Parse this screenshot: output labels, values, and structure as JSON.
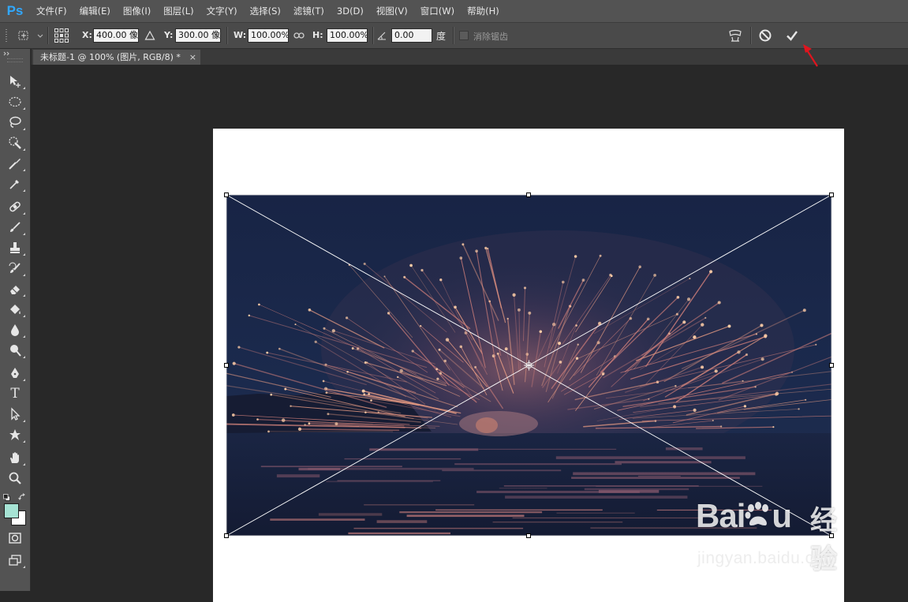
{
  "app": {
    "logo": "Ps",
    "accent_color": "#31a8ff"
  },
  "menu": [
    {
      "label": "文件(F)"
    },
    {
      "label": "编辑(E)"
    },
    {
      "label": "图像(I)"
    },
    {
      "label": "图层(L)"
    },
    {
      "label": "文字(Y)"
    },
    {
      "label": "选择(S)"
    },
    {
      "label": "滤镜(T)"
    },
    {
      "label": "3D(D)"
    },
    {
      "label": "视图(V)"
    },
    {
      "label": "窗口(W)"
    },
    {
      "label": "帮助(H)"
    }
  ],
  "options": {
    "x_label": "X:",
    "x_value": "400.00 像",
    "y_label": "Y:",
    "y_value": "300.00 像",
    "w_label": "W:",
    "w_value": "100.00%",
    "h_label": "H:",
    "h_value": "100.00%",
    "angle_value": "0.00",
    "angle_unit": "度",
    "antialias_label": "消除锯齿",
    "antialias_checked": false,
    "icons": [
      "transform-tool-icon",
      "reference-point-icon",
      "relative-delta-icon",
      "link-icon",
      "angle-icon",
      "warp-icon",
      "cancel-icon",
      "commit-icon"
    ]
  },
  "document": {
    "tab_title": "未标题-1 @ 100% (图片, RGB/8) *",
    "close_glyph": "×"
  },
  "tools": [
    "move-tool-icon",
    "marquee-tool-icon",
    "lasso-tool-icon",
    "quick-select-tool-icon",
    "crop-tool-icon",
    "eyedropper-tool-icon",
    "healing-brush-tool-icon",
    "brush-tool-icon",
    "clone-stamp-tool-icon",
    "history-brush-tool-icon",
    "eraser-tool-icon",
    "paint-bucket-tool-icon",
    "blur-tool-icon",
    "dodge-tool-icon",
    "pen-tool-icon",
    "type-tool-icon",
    "path-select-tool-icon",
    "custom-shape-tool-icon",
    "hand-tool-icon",
    "zoom-tool-icon"
  ],
  "type_tool_glyph": "T",
  "colors": {
    "foreground": "#a6e3d4",
    "background": "#ffffff"
  },
  "annotation": {
    "arrow_color": "#e0141e"
  },
  "watermark": {
    "brand": "Bai",
    "brand_suffix": "u",
    "product": "经验",
    "url": "jingyan.baidu.com"
  }
}
